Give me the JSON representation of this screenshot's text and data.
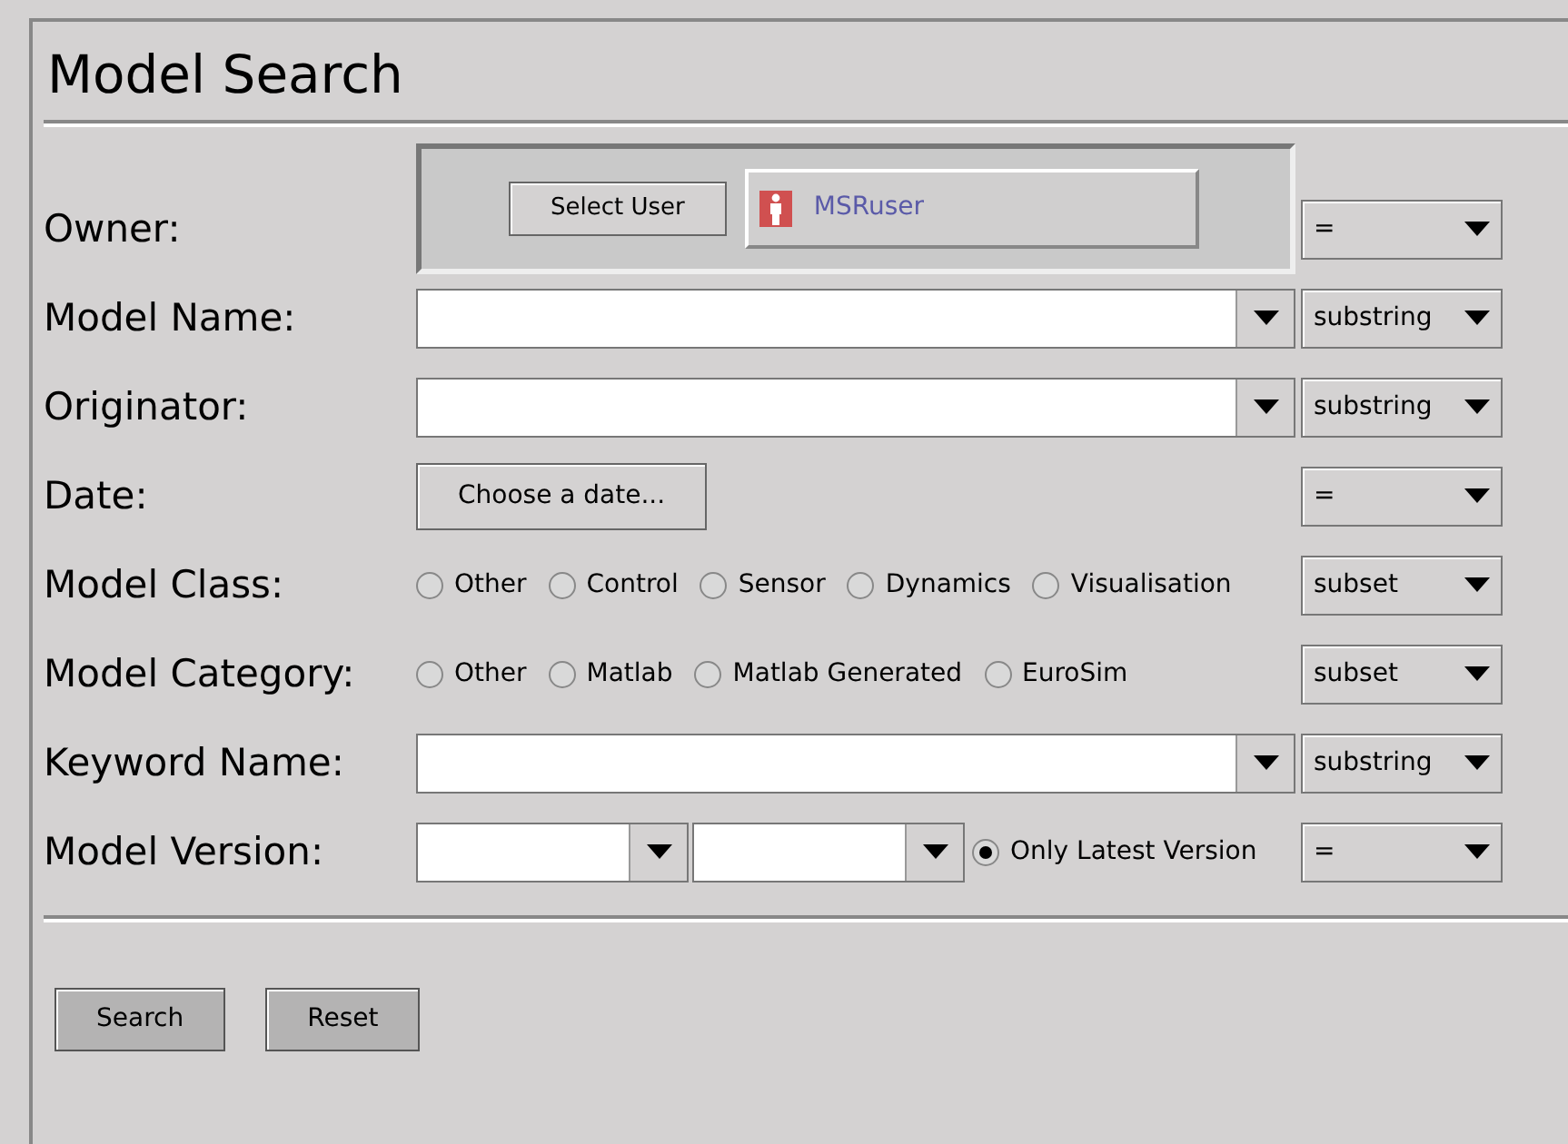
{
  "title": "Model Search",
  "rows": [
    {
      "label": "Owner:",
      "kind": "user",
      "button": "Select User",
      "user": "MSRuser",
      "operator": "="
    },
    {
      "label": "Model Name:",
      "kind": "combo",
      "operator": "substring"
    },
    {
      "label": "Originator:",
      "kind": "combo",
      "operator": "substring"
    },
    {
      "label": "Date:",
      "kind": "date",
      "button": "Choose a date...",
      "operator": "="
    },
    {
      "label": "Model Class:",
      "kind": "radios",
      "options": [
        {
          "label": "Other",
          "selected": false
        },
        {
          "label": "Control",
          "selected": false
        },
        {
          "label": "Sensor",
          "selected": false
        },
        {
          "label": "Dynamics",
          "selected": false
        },
        {
          "label": "Visualisation",
          "selected": false
        }
      ],
      "operator": "subset"
    },
    {
      "label": "Model Category:",
      "kind": "radios",
      "options": [
        {
          "label": "Other",
          "selected": false
        },
        {
          "label": "Matlab",
          "selected": false
        },
        {
          "label": "Matlab Generated",
          "selected": false
        },
        {
          "label": "EuroSim",
          "selected": false
        }
      ],
      "operator": "subset"
    },
    {
      "label": "Keyword Name:",
      "kind": "combo",
      "operator": "substring"
    },
    {
      "label": "Model Version:",
      "kind": "version",
      "latest": {
        "label": "Only Latest Version",
        "selected": true
      },
      "operator": "="
    }
  ],
  "buttons": [
    "Search",
    "Reset"
  ]
}
